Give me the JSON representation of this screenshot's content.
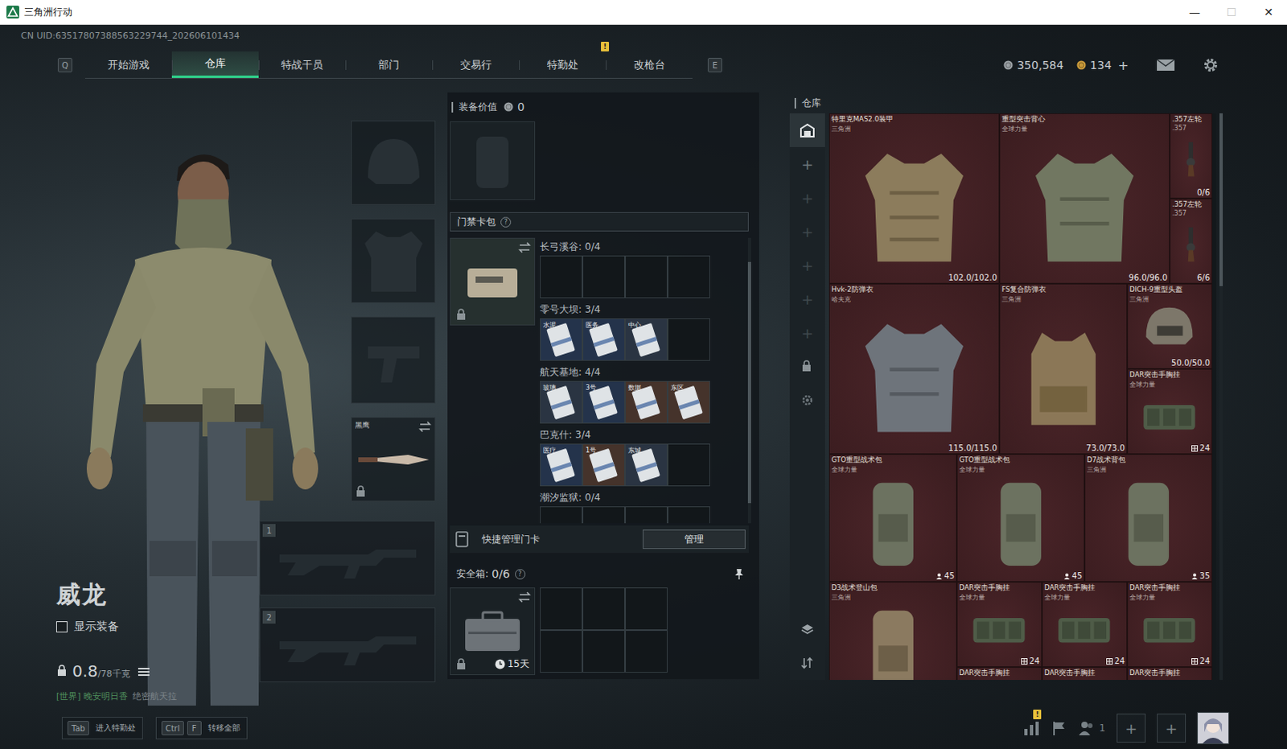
{
  "window": {
    "title": "三角洲行动",
    "controls": [
      {
        "glyph": "—",
        "disabled": false
      },
      {
        "glyph": "☐",
        "disabled": true
      },
      {
        "glyph": "✕",
        "disabled": false
      }
    ]
  },
  "uid": "CN UID:63517807388563229744_202606101434",
  "nav": {
    "prev_key": "Q",
    "next_key": "E",
    "tabs": [
      {
        "label": "开始游戏",
        "selected": false
      },
      {
        "label": "仓库",
        "selected": true
      },
      {
        "label": "特战干员",
        "selected": false
      },
      {
        "label": "部门",
        "selected": false
      },
      {
        "label": "交易行",
        "selected": false
      },
      {
        "label": "特勤处",
        "selected": false,
        "badge": "!"
      },
      {
        "label": "改枪台",
        "selected": false
      }
    ]
  },
  "currency": [
    {
      "kind": "silver",
      "amount": "350,584"
    },
    {
      "kind": "gold",
      "amount": "134",
      "action": "+"
    }
  ],
  "operator": {
    "name": "威龙",
    "show_gear": {
      "label": "显示装备",
      "checked": false
    },
    "weight": "0.8",
    "weight_limit": "/78千克",
    "weight_locked": true
  },
  "chat": {
    "channel": "[世界] 晚安明日香",
    "message": "绝密航天拉"
  },
  "gear_slots": [
    {
      "kind": "helmet"
    },
    {
      "kind": "armor"
    },
    {
      "kind": "pistol"
    },
    {
      "kind": "melee",
      "label": "黑鹰",
      "locked": true
    }
  ],
  "weapon_slots": [
    {
      "number": "1"
    },
    {
      "number": "2"
    }
  ],
  "loadout": {
    "label": "装备价值",
    "value": "0"
  },
  "keycard_pack": {
    "title": "门禁卡包",
    "help": "?",
    "locked": true,
    "maps": [
      {
        "name": "长弓溪谷:",
        "count": "0/4",
        "slots": 4,
        "cards": []
      },
      {
        "name": "零号大坝:",
        "count": "3/4",
        "slots": 4,
        "cards": [
          {
            "label": "水泥",
            "color": "#24334b"
          },
          {
            "label": "医务",
            "color": "#24334b"
          },
          {
            "label": "中心",
            "color": "#2a3442"
          }
        ]
      },
      {
        "name": "航天基地:",
        "count": "4/4",
        "slots": 4,
        "cards": [
          {
            "label": "玻璃",
            "color": "#2a3442"
          },
          {
            "label": "3号",
            "color": "#24334b"
          },
          {
            "label": "数据",
            "color": "#45332b"
          },
          {
            "label": "东区",
            "color": "#45332b"
          }
        ]
      },
      {
        "name": "巴克什:",
        "count": "3/4",
        "slots": 4,
        "cards": [
          {
            "label": "医疗",
            "color": "#24334b"
          },
          {
            "label": "1号",
            "color": "#45332b"
          },
          {
            "label": "东城",
            "color": "#2a3442"
          }
        ]
      },
      {
        "name": "潮汐监狱:",
        "count": "0/4",
        "slots": 4,
        "cards": []
      }
    ]
  },
  "quick_manage": {
    "label": "快捷管理门卡",
    "button": "管理"
  },
  "safebox": {
    "label": "安全箱:",
    "count": "0/6",
    "help": "?",
    "timer": "15天",
    "locked": true,
    "capacity": 6
  },
  "warehouse": {
    "title": "仓库",
    "sidebar": [
      {
        "kind": "warehouse",
        "selected": true
      },
      {
        "kind": "add",
        "glyph": "+",
        "selected": false,
        "disabled": false
      },
      {
        "kind": "add",
        "glyph": "+",
        "selected": false,
        "disabled": true
      },
      {
        "kind": "add",
        "glyph": "+",
        "selected": false,
        "disabled": true
      },
      {
        "kind": "add",
        "glyph": "+",
        "selected": false,
        "disabled": true
      },
      {
        "kind": "add",
        "glyph": "+",
        "selected": false,
        "disabled": true
      },
      {
        "kind": "add",
        "glyph": "+",
        "selected": false,
        "disabled": true
      },
      {
        "kind": "lock",
        "selected": false
      },
      {
        "kind": "settings",
        "selected": false
      }
    ],
    "tools": [
      {
        "kind": "layers"
      },
      {
        "kind": "sort"
      }
    ],
    "items": [
      {
        "name": "特里克MAS2.0装甲",
        "brand": "三角洲",
        "reading": "102.0/102.0",
        "kind": "armor",
        "color": "#4b2529"
      },
      {
        "name": "重型突击背心",
        "brand": "全球力量",
        "reading": "96.0/96.0",
        "kind": "vest",
        "color": "#4b2529"
      },
      {
        "name": ".357左轮",
        "brand": ".357",
        "reading": "0/6",
        "kind": "revolver",
        "color": "#4b2529"
      },
      {
        "name": ".357左轮",
        "brand": ".357",
        "reading": "6/6",
        "kind": "revolver",
        "color": "#4b2529"
      },
      {
        "name": "Hvk-2防弹衣",
        "brand": "哈夫克",
        "reading": "115.0/115.0",
        "kind": "grayarmor",
        "color": "#4b2529"
      },
      {
        "name": "FS复合防弹衣",
        "brand": "三角洲",
        "reading": "73.0/73.0",
        "kind": "platecarrier",
        "color": "#4b2529"
      },
      {
        "name": "DICH-9重型头盔",
        "brand": "三角洲",
        "reading": "50.0/50.0",
        "kind": "helmet",
        "color": "#4b2529"
      },
      {
        "name": "DAR突击手胸挂",
        "brand": "全球力量",
        "reading": "24",
        "kind": "rig",
        "color": "#4b2529"
      },
      {
        "name": "GTO重型战术包",
        "brand": "全球力量",
        "reading": "45",
        "kind": "backpack",
        "color": "#4b2529"
      },
      {
        "name": "GTO重型战术包",
        "brand": "全球力量",
        "reading": "45",
        "kind": "backpack",
        "color": "#4b2529"
      },
      {
        "name": "D7战术背包",
        "brand": "三角洲",
        "reading": "35",
        "kind": "backpack",
        "color": "#4b2529"
      },
      {
        "name": "D3战术登山包",
        "brand": "三角洲",
        "kind": "climbpack",
        "color": "#4b2529"
      },
      {
        "name": "DAR突击手胸挂",
        "brand": "全球力量",
        "reading": "24",
        "kind": "rig",
        "color": "#4b2529"
      },
      {
        "name": "DAR突击手胸挂",
        "brand": "全球力量",
        "reading": "24",
        "kind": "rig",
        "color": "#4b2529"
      },
      {
        "name": "DAR突击手胸挂",
        "brand": "全球力量",
        "reading": "24",
        "kind": "rig",
        "color": "#4b2529"
      },
      {
        "name": "DAR突击手胸挂",
        "kind": "rig",
        "color": "#4b2529"
      },
      {
        "name": "DAR突击手胸挂",
        "kind": "rig",
        "color": "#4b2529"
      },
      {
        "name": "DAR突击手胸挂",
        "kind": "rig",
        "color": "#4b2529"
      }
    ]
  },
  "hints": [
    {
      "keys": [
        "Tab"
      ],
      "label": "进入特勤处"
    },
    {
      "keys": [
        "Ctrl",
        "F"
      ],
      "label": "转移全部"
    }
  ],
  "social": [
    {
      "kind": "stats",
      "badge": "!"
    },
    {
      "kind": "flag"
    },
    {
      "kind": "squad",
      "count": "1"
    },
    {
      "kind": "slot",
      "glyph": "+"
    },
    {
      "kind": "slot",
      "glyph": "+"
    },
    {
      "kind": "avatar"
    }
  ]
}
